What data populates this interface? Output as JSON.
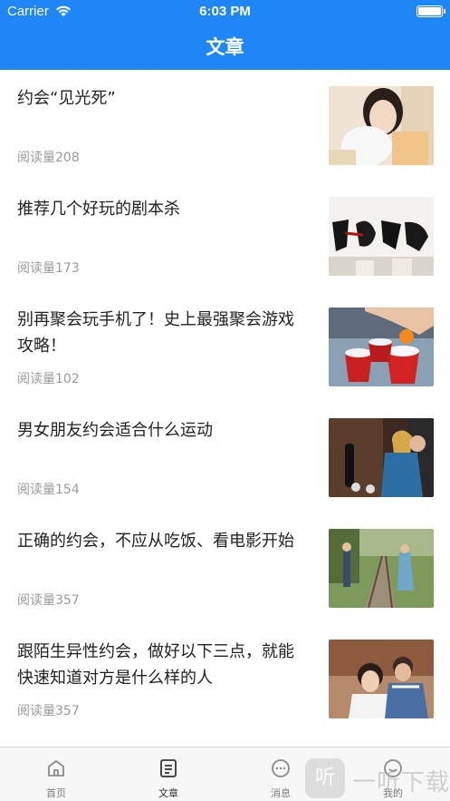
{
  "status_bar": {
    "carrier": "Carrier",
    "time": "6:03 PM"
  },
  "nav": {
    "title": "文章"
  },
  "articles": [
    {
      "title": "约会“见光死”",
      "views": "阅读量208",
      "image": "woman-with-balloon-photo"
    },
    {
      "title": "推荐几个好玩的剧本杀",
      "views": "阅读量173",
      "image": "calligraphy-photo"
    },
    {
      "title": "别再聚会玩手机了！史上最强聚会游戏攻略！",
      "views": "阅读量102",
      "image": "beer-pong-cups-photo"
    },
    {
      "title": "男女朋友约会适合什么运动",
      "views": "阅读量154",
      "image": "couple-skateboard-photo"
    },
    {
      "title": "正确的约会，不应从吃饭、看电影开始",
      "views": "阅读量357",
      "image": "couple-railway-photo"
    },
    {
      "title": "跟陌生异性约会，做好以下三点，就能快速知道对方是什么样的人",
      "views": "阅读量357",
      "image": "couple-laughing-photo"
    }
  ],
  "tabs": [
    {
      "label": "首页",
      "icon": "home-icon",
      "active": false
    },
    {
      "label": "文章",
      "icon": "article-icon",
      "active": true
    },
    {
      "label": "消息",
      "icon": "message-icon",
      "active": false
    },
    {
      "label": "我的",
      "icon": "profile-icon",
      "active": false
    }
  ],
  "watermark": {
    "badge": "听",
    "text": "一听下载"
  },
  "colors": {
    "primary": "#1e86f5",
    "meta_text": "#9a9a9a",
    "tabbar_bg": "#f7f7f7"
  }
}
